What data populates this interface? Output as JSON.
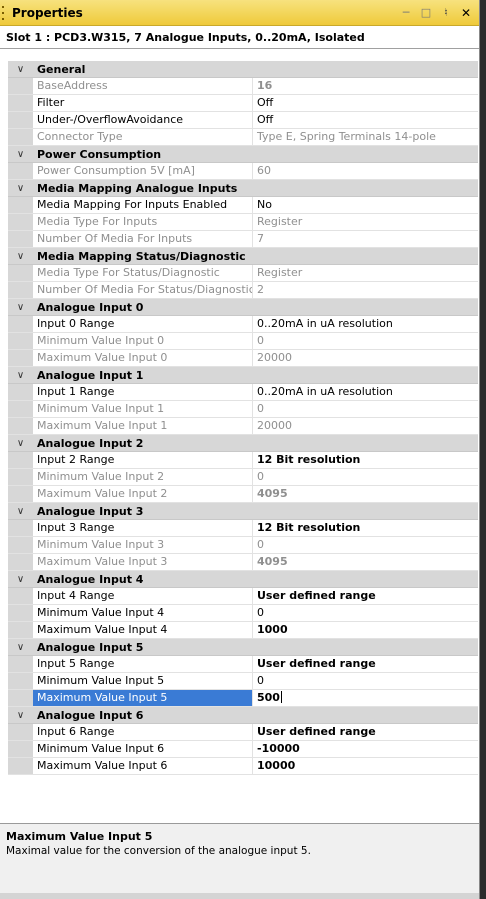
{
  "window": {
    "title": "Properties"
  },
  "slot": {
    "label": "Slot 1 : PCD3.W315, 7 Analogue Inputs, 0..20mA, Isolated"
  },
  "sections": [
    {
      "title": "General",
      "rows": [
        {
          "name": "BaseAddress",
          "value": "16",
          "disabled": true,
          "bold": true
        },
        {
          "name": "Filter",
          "value": "Off",
          "disabled": false,
          "bold": false
        },
        {
          "name": "Under-/OverflowAvoidance",
          "value": "Off",
          "disabled": false,
          "bold": false
        },
        {
          "name": "Connector Type",
          "value": "Type E, Spring Terminals 14-pole",
          "disabled": true,
          "bold": false
        }
      ]
    },
    {
      "title": "Power Consumption",
      "rows": [
        {
          "name": "Power Consumption 5V [mA]",
          "value": "60",
          "disabled": true,
          "bold": false
        }
      ]
    },
    {
      "title": "Media Mapping Analogue Inputs",
      "rows": [
        {
          "name": "Media Mapping For Inputs Enabled",
          "value": "No",
          "disabled": false,
          "bold": false
        },
        {
          "name": "Media Type For Inputs",
          "value": "Register",
          "disabled": true,
          "bold": false
        },
        {
          "name": "Number Of Media For Inputs",
          "value": "7",
          "disabled": true,
          "bold": false
        }
      ]
    },
    {
      "title": "Media Mapping Status/Diagnostic",
      "rows": [
        {
          "name": "Media Type For Status/Diagnostic",
          "value": "Register",
          "disabled": true,
          "bold": false
        },
        {
          "name": "Number Of Media For Status/Diagnostic",
          "value": "2",
          "disabled": true,
          "bold": false
        }
      ]
    },
    {
      "title": "Analogue Input 0",
      "rows": [
        {
          "name": "Input 0 Range",
          "value": "0..20mA in uA resolution",
          "disabled": false,
          "bold": false
        },
        {
          "name": "Minimum Value Input 0",
          "value": "0",
          "disabled": true,
          "bold": false
        },
        {
          "name": "Maximum Value Input 0",
          "value": "20000",
          "disabled": true,
          "bold": false
        }
      ]
    },
    {
      "title": "Analogue Input 1",
      "rows": [
        {
          "name": "Input 1 Range",
          "value": "0..20mA in uA resolution",
          "disabled": false,
          "bold": false
        },
        {
          "name": "Minimum Value Input 1",
          "value": "0",
          "disabled": true,
          "bold": false
        },
        {
          "name": "Maximum Value Input 1",
          "value": "20000",
          "disabled": true,
          "bold": false
        }
      ]
    },
    {
      "title": "Analogue Input 2",
      "rows": [
        {
          "name": "Input 2 Range",
          "value": "12 Bit resolution",
          "disabled": false,
          "bold": true
        },
        {
          "name": "Minimum Value Input 2",
          "value": "0",
          "disabled": true,
          "bold": false
        },
        {
          "name": "Maximum Value Input 2",
          "value": "4095",
          "disabled": true,
          "bold": true
        }
      ]
    },
    {
      "title": "Analogue Input 3",
      "rows": [
        {
          "name": "Input 3 Range",
          "value": "12 Bit resolution",
          "disabled": false,
          "bold": true
        },
        {
          "name": "Minimum Value Input 3",
          "value": "0",
          "disabled": true,
          "bold": false
        },
        {
          "name": "Maximum Value Input 3",
          "value": "4095",
          "disabled": true,
          "bold": true
        }
      ]
    },
    {
      "title": "Analogue Input 4",
      "rows": [
        {
          "name": "Input 4 Range",
          "value": "User defined range",
          "disabled": false,
          "bold": true
        },
        {
          "name": "Minimum Value Input 4",
          "value": "0",
          "disabled": false,
          "bold": false
        },
        {
          "name": "Maximum Value Input 4",
          "value": "1000",
          "disabled": false,
          "bold": true
        }
      ]
    },
    {
      "title": "Analogue Input 5",
      "rows": [
        {
          "name": "Input 5 Range",
          "value": "User defined range",
          "disabled": false,
          "bold": true
        },
        {
          "name": "Minimum Value Input 5",
          "value": "0",
          "disabled": false,
          "bold": false
        },
        {
          "name": "Maximum Value Input 5",
          "value": "500",
          "disabled": false,
          "bold": true,
          "selected": true
        }
      ]
    },
    {
      "title": "Analogue Input 6",
      "rows": [
        {
          "name": "Input 6 Range",
          "value": "User defined range",
          "disabled": false,
          "bold": true
        },
        {
          "name": "Minimum Value Input 6",
          "value": "-10000",
          "disabled": false,
          "bold": true
        },
        {
          "name": "Maximum Value Input 6",
          "value": "10000",
          "disabled": false,
          "bold": true
        }
      ]
    }
  ],
  "description": {
    "title": "Maximum Value Input 5",
    "text": "Maximal value for the conversion of the analogue input 5."
  },
  "icons": {
    "collapse": "chevron-down-icon",
    "pin": "pin-icon",
    "close": "close-icon",
    "minimize": "minimize-icon",
    "maximize": "maximize-icon"
  },
  "colors": {
    "titlebar": "#efca3a",
    "selection": "#3a7bd5",
    "category": "#d7d7d7"
  }
}
